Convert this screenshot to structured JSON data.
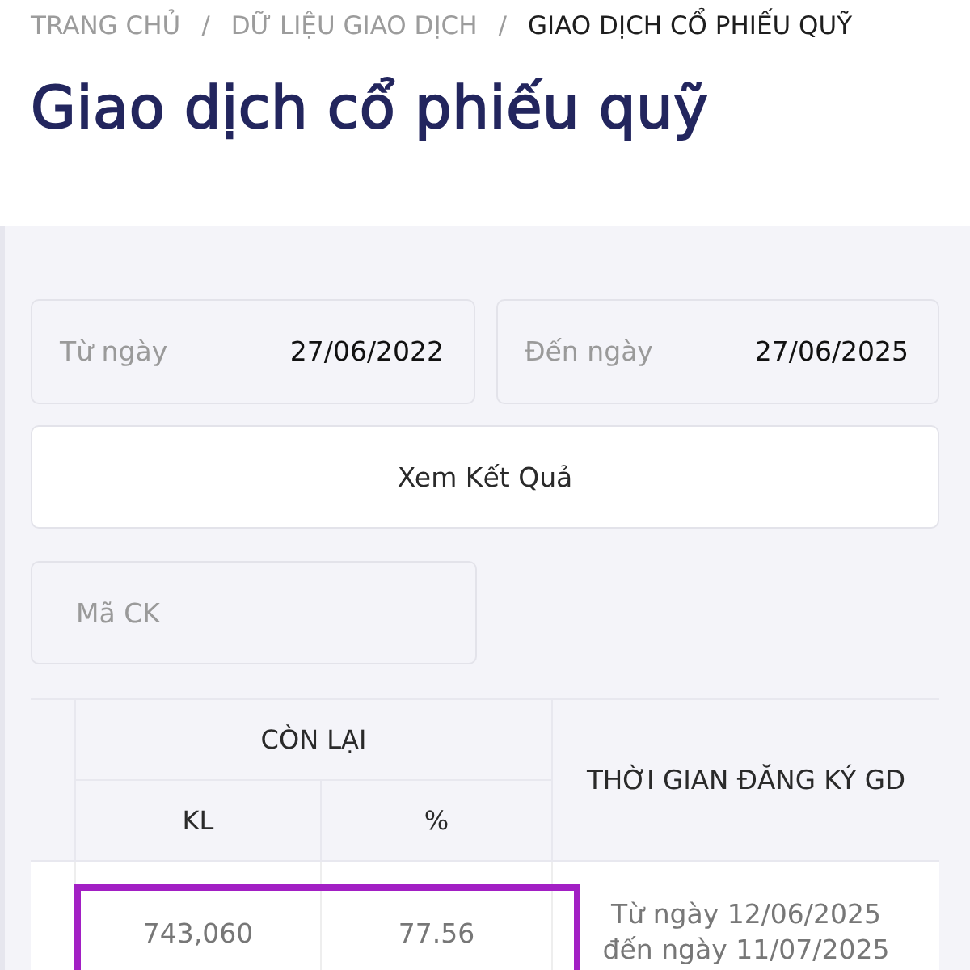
{
  "breadcrumb": {
    "separator": "/",
    "items": [
      {
        "label": "TRANG CHỦ",
        "current": false
      },
      {
        "label": "DỮ LIỆU GIAO DỊCH",
        "current": false
      },
      {
        "label": "GIAO DỊCH CỔ PHIẾU QUỸ",
        "current": true
      }
    ]
  },
  "title": "Giao dịch cổ phiếu quỹ",
  "filters": {
    "dates": [
      {
        "label": "Từ ngày",
        "value": "27/06/2022"
      },
      {
        "label": "Đến ngày",
        "value": "27/06/2025"
      }
    ],
    "submit": "Xem Kết Quả",
    "symbol": {
      "placeholder": "Mã CK"
    }
  },
  "table": {
    "group_header": "CÒN LẠI",
    "columns": [
      "KL",
      "%"
    ],
    "time_header": "THỜI GIAN ĐĂNG KÝ GD",
    "rows": [
      {
        "volume": "743,060",
        "percent": "77.56",
        "period": "Từ ngày 12/06/2025 đến ngày 11/07/2025",
        "highlighted": true
      }
    ]
  }
}
